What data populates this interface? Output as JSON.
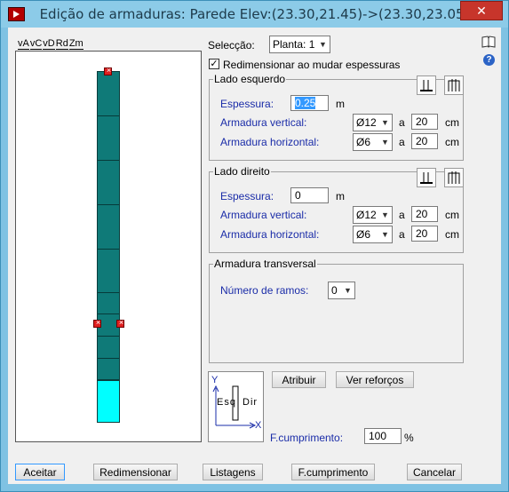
{
  "window": {
    "title": "Edição de armaduras: Parede Elev:(23.30,21.45)->(23.30,23.05)",
    "close": "✕"
  },
  "tabs": [
    "vA",
    "vC",
    "vD",
    "Rd",
    "Zm"
  ],
  "selection": {
    "label": "Selecção:",
    "value": "Planta: 1"
  },
  "resize_checkbox": {
    "label": "Redimensionar ao mudar espessuras",
    "checked": true
  },
  "left_side": {
    "title": "Lado esquerdo",
    "thickness_label": "Espessura:",
    "thickness_value": "0.25",
    "thickness_unit": "m",
    "vertical_label": "Armadura vertical:",
    "vertical_bar": "Ø12",
    "vertical_spacing": "20",
    "horizontal_label": "Armadura horizontal:",
    "horizontal_bar": "Ø6",
    "horizontal_spacing": "20",
    "a": "a",
    "cm": "cm"
  },
  "right_side": {
    "title": "Lado direito",
    "thickness_label": "Espessura:",
    "thickness_value": "0",
    "thickness_unit": "m",
    "vertical_label": "Armadura vertical:",
    "vertical_bar": "Ø12",
    "vertical_spacing": "20",
    "horizontal_label": "Armadura horizontal:",
    "horizontal_bar": "Ø6",
    "horizontal_spacing": "20",
    "a": "a",
    "cm": "cm"
  },
  "transverse": {
    "title": "Armadura transversal",
    "legs_label": "Número de ramos:",
    "legs_value": "0"
  },
  "diagram": {
    "y": "Y",
    "x": "X",
    "esq": "Esq",
    "dir": "Dir"
  },
  "actions": {
    "assign": "Atribuir",
    "reinforcements": "Ver reforços"
  },
  "length_factor": {
    "label": "F.cumprimento:",
    "value": "100",
    "unit": "%"
  },
  "footer": {
    "accept": "Aceitar",
    "resize": "Redimensionar",
    "listings": "Listagens",
    "length": "F.cumprimento",
    "cancel": "Cancelar"
  },
  "colors": {
    "wall": "#0f7a78",
    "wall_bottom": "#00ffff",
    "marker": "#e02020"
  }
}
